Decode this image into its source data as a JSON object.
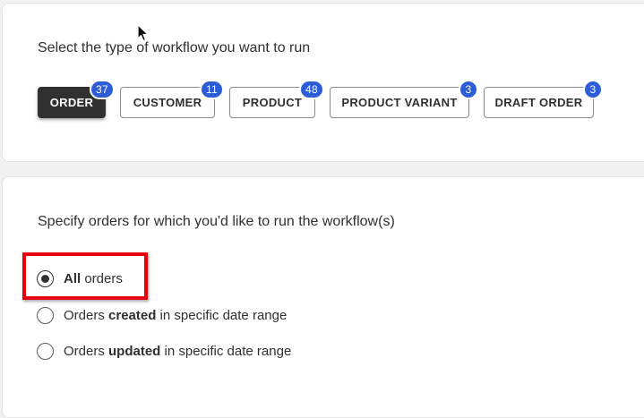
{
  "workflow_type": {
    "heading": "Select the type of workflow you want to run",
    "options": [
      {
        "label": "ORDER",
        "count": "37",
        "active": true
      },
      {
        "label": "CUSTOMER",
        "count": "11",
        "active": false
      },
      {
        "label": "PRODUCT",
        "count": "48",
        "active": false
      },
      {
        "label": "PRODUCT VARIANT",
        "count": "3",
        "active": false
      },
      {
        "label": "DRAFT ORDER",
        "count": "3",
        "active": false
      }
    ]
  },
  "order_scope": {
    "heading": "Specify orders for which you'd like to run the workflow(s)",
    "options": [
      {
        "pre": "",
        "bold": "All",
        "post": " orders",
        "selected": true
      },
      {
        "pre": "Orders ",
        "bold": "created",
        "post": " in specific date range",
        "selected": false
      },
      {
        "pre": "Orders ",
        "bold": "updated",
        "post": " in specific date range",
        "selected": false
      }
    ]
  },
  "colors": {
    "active_button": "#303030",
    "badge": "#2c5cd6",
    "highlight": "#e8000b"
  },
  "icons": {
    "cursor": "mouse-pointer-icon"
  }
}
